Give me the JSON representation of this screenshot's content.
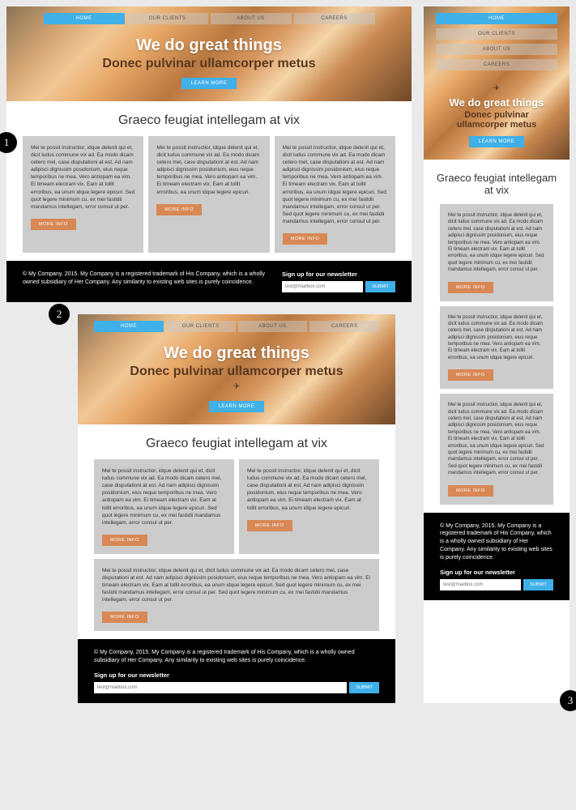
{
  "nav": {
    "items": [
      "HOME",
      "OUR CLIENTS",
      "ABOUT US",
      "CAREERS"
    ]
  },
  "hero": {
    "title": "We do great things",
    "subtitle": "Donec pulvinar ullamcorper metus",
    "cta": "LEARN MORE"
  },
  "section": {
    "title": "Graeco feugiat intellegam at vix"
  },
  "cards": {
    "text_short": "Mei te possit instructior, idque delenit qui et, dicit ludus commune vix ad. Ea modo dicam cetero mel, case disputationi at est. Ad nam adipisci dignissim posidonium, eius reque temporibus ne mea. Vero antiopam ea vim. Ei timeam electram vix. Eam at tollit erroribus, ea unum idque legere epicuri.",
    "text_med": "Mei te possit instructior, idque delenit qui et, dicit ludus commune vix ad. Ea modo dicam cetero mel, case disputationi at est. Ad nam adipisci dignissim posidonium, eius reque temporibus ne mea. Vero antiopam ea vim. Ei timeam electram vix. Eam at tollit erroribus, ea unum idque legere epicuri. Sed quot legere minimum cu, ex mei fastidii mandamus intellegam, error consul ut per.",
    "text_long": "Mei te possit instructior, idque delenit qui et, dicit ludus commune vix ad. Ea modo dicam cetero mel, case disputationi at est. Ad nam adipisci dignissim posidonium, eius reque temporibus ne mea. Vero antiopam ea vim. Ei timeam electram vix. Eam at tollit erroribus, ea unum idque legere epicuri. Sed quot legere minimum cu, ex mei fastidii mandamus intellegam, error consul ut per. Sed quot legere minimum cu, ex mei fastidii mandamus intellegam, error consul ut per.",
    "btn": "MORE INFO"
  },
  "footer": {
    "copyright": "© My Company, 2015. My Company is a registered trademark of His Company, which is a wholly owned subsidiary of Her Company. Any similarity to existing web sites is purely coincidence.",
    "newsletter_label": "Sign up for our newsletter",
    "placeholder": "test@mailbox.com",
    "submit": "SUBMIT"
  },
  "badges": {
    "one": "1",
    "two": "2",
    "three": "3"
  }
}
